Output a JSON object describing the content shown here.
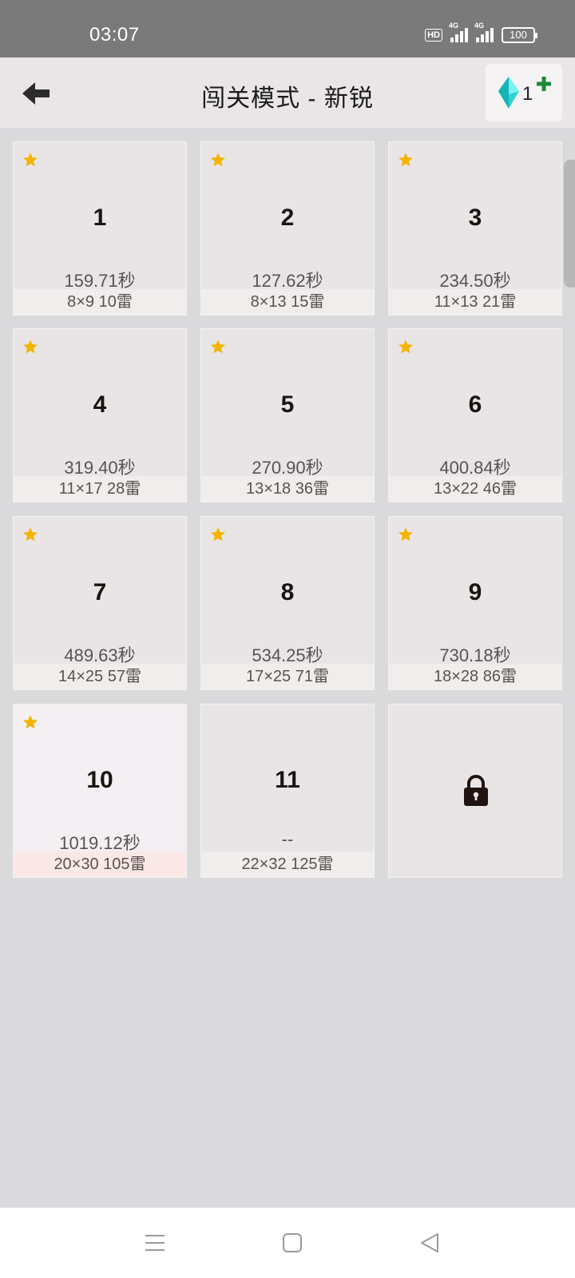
{
  "status_bar": {
    "time": "03:07",
    "hd_label": "HD",
    "network_1": "4G",
    "network_2": "4G",
    "battery": "100"
  },
  "header": {
    "title": "闯关模式 - 新锐",
    "back_icon": "arrow-left-icon",
    "gem_icon": "diamond-icon",
    "gem_count": "1",
    "add_icon": "plus-icon"
  },
  "levels": [
    {
      "number": "1",
      "time": "159.71秒",
      "info": "8×9  10雷",
      "starred": true
    },
    {
      "number": "2",
      "time": "127.62秒",
      "info": "8×13  15雷",
      "starred": true
    },
    {
      "number": "3",
      "time": "234.50秒",
      "info": "11×13  21雷",
      "starred": true
    },
    {
      "number": "4",
      "time": "319.40秒",
      "info": "11×17  28雷",
      "starred": true
    },
    {
      "number": "5",
      "time": "270.90秒",
      "info": "13×18  36雷",
      "starred": true
    },
    {
      "number": "6",
      "time": "400.84秒",
      "info": "13×22  46雷",
      "starred": true
    },
    {
      "number": "7",
      "time": "489.63秒",
      "info": "14×25  57雷",
      "starred": true
    },
    {
      "number": "8",
      "time": "534.25秒",
      "info": "17×25  71雷",
      "starred": true
    },
    {
      "number": "9",
      "time": "730.18秒",
      "info": "18×28  86雷",
      "starred": true
    },
    {
      "number": "10",
      "time": "1019.12秒",
      "info": "20×30  105雷",
      "starred": true
    },
    {
      "number": "11",
      "time": "--",
      "info": "22×32  125雷",
      "starred": false
    }
  ],
  "locked_level": {
    "icon": "lock-icon"
  },
  "nav_bar": {
    "menu_icon": "menu-icon",
    "home_icon": "home-square-icon",
    "back_icon": "back-triangle-icon"
  },
  "colors": {
    "star": "#f5b400",
    "gem": "#2fd4d4",
    "plus": "#1a8a3a",
    "current_level_bg": "#f3eff2"
  }
}
